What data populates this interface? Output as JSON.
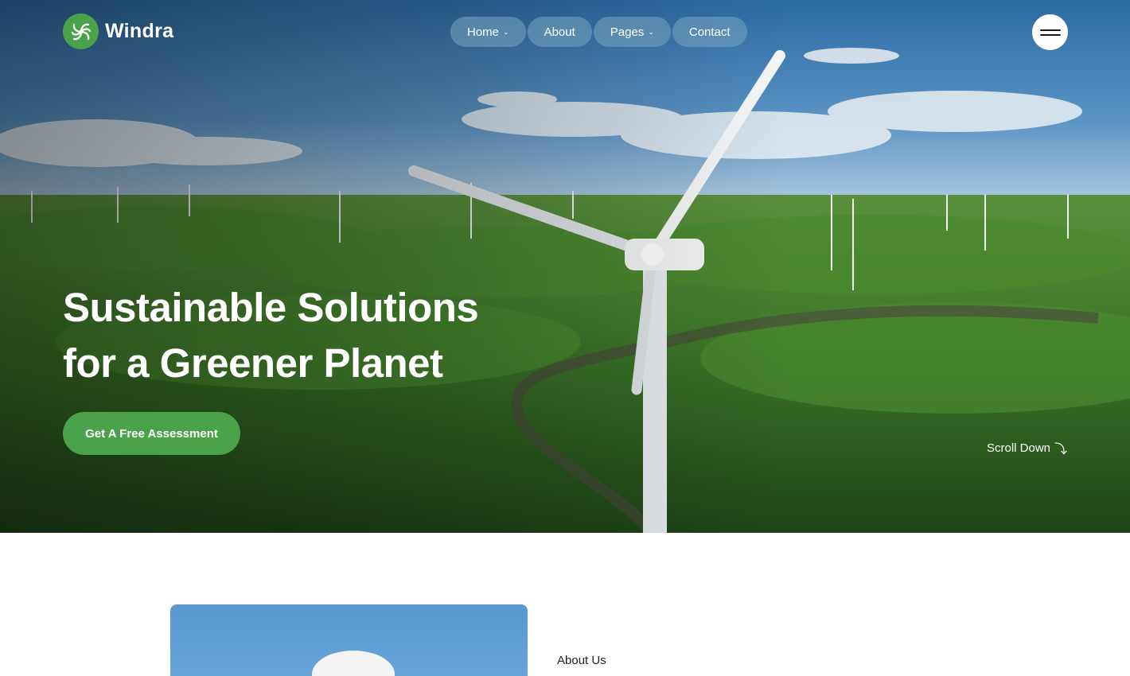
{
  "brand": {
    "name": "Windra",
    "logo_icon": "swirl-fan-icon",
    "accent": "#4aa34a"
  },
  "nav": {
    "items": [
      {
        "label": "Home",
        "has_dropdown": true
      },
      {
        "label": "About",
        "has_dropdown": false
      },
      {
        "label": "Pages",
        "has_dropdown": true
      },
      {
        "label": "Contact",
        "has_dropdown": false
      }
    ],
    "chevron": "⌄",
    "menu_icon": "hamburger-icon"
  },
  "hero": {
    "title_line1": "Sustainable Solutions",
    "title_line2": "for a Greener Planet",
    "cta_label": "Get A Free Assessment",
    "scroll_label": "Scroll Down",
    "scroll_arrow": "⤵"
  },
  "about": {
    "label": "About Us"
  }
}
